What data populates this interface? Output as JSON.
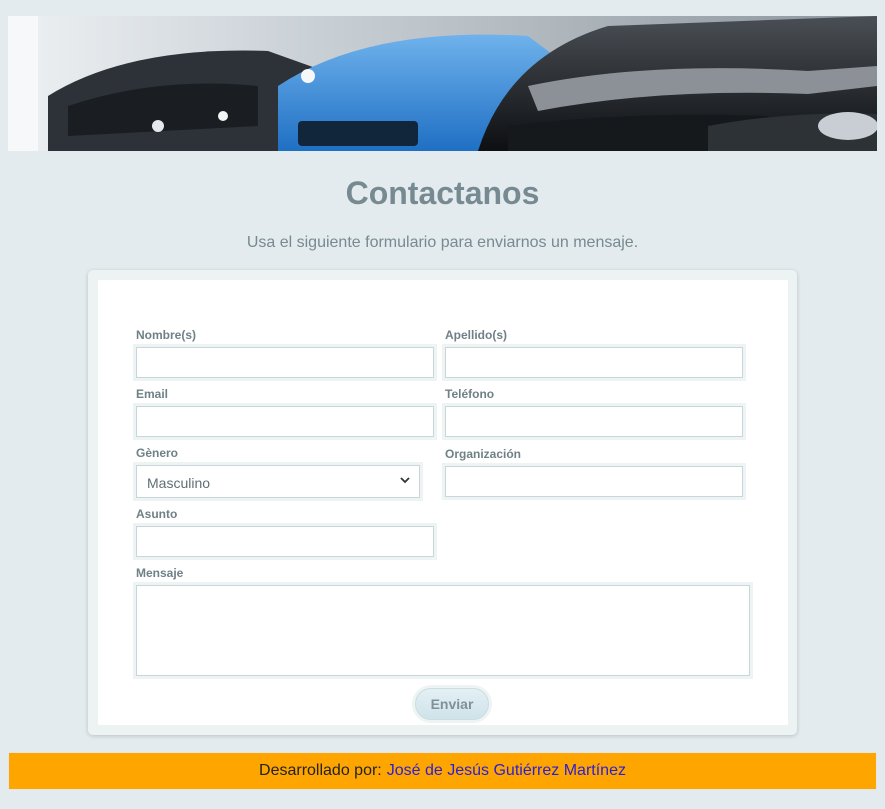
{
  "banner": {
    "image_alt": "cars-banner"
  },
  "page": {
    "title": "Contactanos",
    "subtitle": "Usa el siguiente formulario para enviarnos un mensaje."
  },
  "form": {
    "nombre": {
      "label": "Nombre(s)",
      "value": ""
    },
    "apellido": {
      "label": "Apellido(s)",
      "value": ""
    },
    "email": {
      "label": "Email",
      "value": ""
    },
    "telefono": {
      "label": "Teléfono",
      "value": ""
    },
    "genero": {
      "label": "Gènero",
      "selected": "Masculino"
    },
    "organizacion": {
      "label": "Organización",
      "value": ""
    },
    "asunto": {
      "label": "Asunto",
      "value": ""
    },
    "mensaje": {
      "label": "Mensaje",
      "value": ""
    },
    "submit_label": "Enviar"
  },
  "footer": {
    "prefix": "Desarrollado por:",
    "author": "José de Jesús Gutiérrez Martínez",
    "bg_color": "#ffa500",
    "link_color": "#2a1fd6"
  }
}
